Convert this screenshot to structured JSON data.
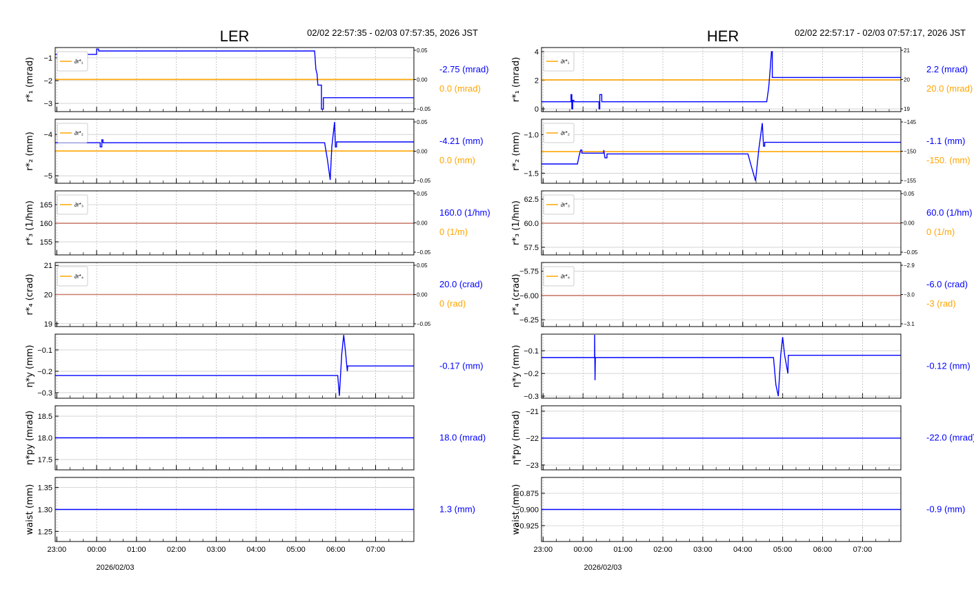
{
  "colors": {
    "series": "#0000ff",
    "reference": "#ffa500",
    "overlap": "#c87d6e",
    "grid": "#cccccc"
  },
  "chart_data": [
    {
      "type": "line",
      "title": "LER",
      "time_range": "02/02 22:57:35 - 02/03 07:57:35, 2026 JST",
      "xlabel": "2026/02/03",
      "x_unit": "hours since 02/02 23:00",
      "xlim": [
        -0.04,
        8.96
      ],
      "xticks": [
        0,
        1,
        2,
        3,
        4,
        5,
        6,
        7,
        8
      ],
      "xtick_labels": [
        "23:00",
        "00:00",
        "01:00",
        "02:00",
        "03:00",
        "04:00",
        "05:00",
        "06:00",
        "07:00"
      ],
      "panels": [
        {
          "ylabel": "r*₁ (mrad)",
          "ylim": [
            -3.36,
            -0.55
          ],
          "yticks": [
            -1,
            -2,
            -3
          ],
          "ytick_labels": [
            "−1",
            "−2",
            "−3"
          ],
          "right_ticks": [
            "0.05",
            "0.00",
            "−0.05"
          ],
          "legend": "∂r*₁",
          "series": [
            [
              -0.04,
              -0.85
            ],
            [
              1.0,
              -0.85
            ],
            [
              1.0,
              -0.62
            ],
            [
              1.05,
              -0.62
            ],
            [
              1.05,
              -0.7
            ],
            [
              6.47,
              -0.7
            ],
            [
              6.5,
              -1.5
            ],
            [
              6.53,
              -1.7
            ],
            [
              6.55,
              -2.2
            ],
            [
              6.64,
              -2.2
            ],
            [
              6.64,
              -3.25
            ],
            [
              6.69,
              -3.25
            ],
            [
              6.69,
              -2.75
            ],
            [
              8.96,
              -2.75
            ]
          ],
          "reference": -1.95,
          "value": "-2.75 (mrad)",
          "ref_value": "0.0 (mrad)"
        },
        {
          "ylabel": "r*₂ (mm)",
          "ylim": [
            -5.18,
            -3.63
          ],
          "yticks": [
            -4,
            -5
          ],
          "ytick_labels": [
            "−4",
            "−5"
          ],
          "right_ticks": [
            "0.05",
            "0.00",
            "−0.05"
          ],
          "legend": "∂r*₂",
          "series": [
            [
              -0.04,
              -4.2
            ],
            [
              1.09,
              -4.2
            ],
            [
              1.09,
              -4.3
            ],
            [
              1.13,
              -4.3
            ],
            [
              1.13,
              -4.13
            ],
            [
              1.16,
              -4.13
            ],
            [
              1.16,
              -4.2
            ],
            [
              6.72,
              -4.2
            ],
            [
              6.79,
              -4.6
            ],
            [
              6.86,
              -5.1
            ],
            [
              6.9,
              -4.3
            ],
            [
              6.97,
              -3.7
            ],
            [
              6.99,
              -4.3
            ],
            [
              7.02,
              -4.3
            ],
            [
              7.02,
              -4.18
            ],
            [
              8.96,
              -4.18
            ]
          ],
          "reference": -4.4,
          "value": "-4.21 (mm)",
          "ref_value": "0.0 (mm)"
        },
        {
          "ylabel": "r*₃ (1/hm)",
          "ylim": [
            151.5,
            168.7
          ],
          "yticks": [
            165,
            160,
            155
          ],
          "ytick_labels": [
            "165",
            "160",
            "155"
          ],
          "right_ticks": [
            "0.05",
            "0.00",
            "−0.05"
          ],
          "legend": "∂r*₃",
          "series": [
            [
              -0.04,
              160
            ],
            [
              8.96,
              160
            ]
          ],
          "reference": 160,
          "value": "160.0 (1/hm)",
          "ref_value": "0 (1/m)"
        },
        {
          "ylabel": "r*₄ (crad)",
          "ylim": [
            18.9,
            21.1
          ],
          "yticks": [
            21,
            20,
            19
          ],
          "ytick_labels": [
            "21",
            "20",
            "19"
          ],
          "right_ticks": [
            "0.05",
            "0.00",
            "−0.05"
          ],
          "legend": "∂r*₄",
          "series": [
            [
              -0.04,
              20
            ],
            [
              8.96,
              20
            ]
          ],
          "reference": 20,
          "value": "20.0 (crad)",
          "ref_value": "0 (rad)"
        },
        {
          "ylabel": "η*y (mm)",
          "ylim": [
            -0.326,
            -0.026
          ],
          "yticks": [
            -0.1,
            -0.2,
            -0.3
          ],
          "ytick_labels": [
            "−0.1",
            "−0.2",
            "−0.3"
          ],
          "right_ticks": [],
          "legend": "",
          "series": [
            [
              -0.04,
              -0.22
            ],
            [
              7.05,
              -0.22
            ],
            [
              7.09,
              -0.315
            ],
            [
              7.15,
              -0.12
            ],
            [
              7.2,
              -0.03
            ],
            [
              7.25,
              -0.12
            ],
            [
              7.29,
              -0.2
            ],
            [
              7.3,
              -0.175
            ],
            [
              8.96,
              -0.175
            ]
          ],
          "reference": null,
          "value": "-0.17 (mm)",
          "ref_value": ""
        },
        {
          "ylabel": "η*py (mrad)",
          "ylim": [
            17.26,
            18.74
          ],
          "yticks": [
            18.5,
            18.0,
            17.5
          ],
          "ytick_labels": [
            "18.5",
            "18.0",
            "17.5"
          ],
          "right_ticks": [],
          "legend": "",
          "series": [
            [
              -0.04,
              18.0
            ],
            [
              8.96,
              18.0
            ]
          ],
          "reference": null,
          "value": "18.0 (mrad)",
          "ref_value": ""
        },
        {
          "ylabel": "waist (mm)",
          "ylim": [
            1.227,
            1.373
          ],
          "yticks": [
            1.35,
            1.3,
            1.25
          ],
          "ytick_labels": [
            "1.35",
            "1.30",
            "1.25"
          ],
          "right_ticks": [],
          "legend": "",
          "series": [
            [
              -0.04,
              1.3
            ],
            [
              8.96,
              1.3
            ]
          ],
          "reference": null,
          "value": "1.3 (mm)",
          "ref_value": ""
        }
      ]
    },
    {
      "type": "line",
      "title": "HER",
      "time_range": "02/02 22:57:17 - 02/03 07:57:17, 2026 JST",
      "xlabel": "2026/02/03",
      "x_unit": "hours since 02/02 23:00",
      "xlim": [
        -0.04,
        8.96
      ],
      "xticks": [
        0,
        1,
        2,
        3,
        4,
        5,
        6,
        7,
        8
      ],
      "xtick_labels": [
        "23:00",
        "00:00",
        "01:00",
        "02:00",
        "03:00",
        "04:00",
        "05:00",
        "06:00",
        "07:00"
      ],
      "panels": [
        {
          "ylabel": "r*₁ (mrad)",
          "ylim": [
            -0.19,
            4.29
          ],
          "yticks": [
            4,
            2,
            0
          ],
          "ytick_labels": [
            "4",
            "2",
            "0"
          ],
          "right_ticks": [
            "21",
            "20",
            "19"
          ],
          "legend": "∂r*₁",
          "series": [
            [
              -0.04,
              0.5
            ],
            [
              0.7,
              0.5
            ],
            [
              0.7,
              1.0
            ],
            [
              0.72,
              1.0
            ],
            [
              0.72,
              0.0
            ],
            [
              0.74,
              0.0
            ],
            [
              0.74,
              0.6
            ],
            [
              0.77,
              0.6
            ],
            [
              0.77,
              0.5
            ],
            [
              1.4,
              0.5
            ],
            [
              1.4,
              0.0
            ],
            [
              1.42,
              0.0
            ],
            [
              1.42,
              1.0
            ],
            [
              1.47,
              1.0
            ],
            [
              1.47,
              0.5
            ],
            [
              5.6,
              0.5
            ],
            [
              5.65,
              1.5
            ],
            [
              5.68,
              2.5
            ],
            [
              5.72,
              4.0
            ],
            [
              5.74,
              4.0
            ],
            [
              5.74,
              2.2
            ],
            [
              8.96,
              2.2
            ]
          ],
          "reference": 2.03,
          "value": "2.2 (mrad)",
          "ref_value": "20.0 (mrad)"
        },
        {
          "ylabel": "r*₂ (mm)",
          "ylim": [
            -1.63,
            -0.8
          ],
          "yticks": [
            -1.0,
            -1.5
          ],
          "ytick_labels": [
            "−1.0",
            "−1.5"
          ],
          "right_ticks": [
            "−145",
            "−150",
            "−155"
          ],
          "legend": "∂r*₂",
          "series": [
            [
              -0.04,
              -1.38
            ],
            [
              0.86,
              -1.38
            ],
            [
              0.9,
              -1.28
            ],
            [
              0.94,
              -1.2
            ],
            [
              0.97,
              -1.2
            ],
            [
              0.97,
              -1.24
            ],
            [
              1.52,
              -1.24
            ],
            [
              1.52,
              -1.2
            ],
            [
              1.55,
              -1.3
            ],
            [
              1.6,
              -1.3
            ],
            [
              1.6,
              -1.25
            ],
            [
              5.13,
              -1.25
            ],
            [
              5.22,
              -1.42
            ],
            [
              5.32,
              -1.6
            ],
            [
              5.4,
              -1.2
            ],
            [
              5.49,
              -0.85
            ],
            [
              5.52,
              -1.15
            ],
            [
              5.55,
              -1.15
            ],
            [
              5.55,
              -1.1
            ],
            [
              8.96,
              -1.1
            ]
          ],
          "reference": -1.22,
          "value": "-1.1 (mm)",
          "ref_value": "-150. (mm)"
        },
        {
          "ylabel": "r*₃ (1/hm)",
          "ylim": [
            56.71,
            63.36
          ],
          "yticks": [
            62.5,
            60.0,
            57.5
          ],
          "ytick_labels": [
            "62.5",
            "60.0",
            "57.5"
          ],
          "right_ticks": [
            "0.05",
            "0.00",
            "−0.05"
          ],
          "legend": "∂r*₃",
          "series": [
            [
              -0.04,
              60
            ],
            [
              8.96,
              60
            ]
          ],
          "reference": 60,
          "value": "60.0 (1/hm)",
          "ref_value": "0 (1/m)"
        },
        {
          "ylabel": "r*₄ (crad)",
          "ylim": [
            -6.32,
            -5.66
          ],
          "yticks": [
            -5.75,
            -6.0,
            -6.25
          ],
          "ytick_labels": [
            "−5.75",
            "−6.00",
            "−6.25"
          ],
          "right_ticks": [
            "−2.9",
            "−3.0",
            "−3.1"
          ],
          "legend": "∂r*₄",
          "series": [
            [
              -0.04,
              -6.0
            ],
            [
              8.96,
              -6.0
            ]
          ],
          "reference": -6.0,
          "value": "-6.0 (crad)",
          "ref_value": "-3 (rad)"
        },
        {
          "ylabel": "η*y (mm)",
          "ylim": [
            -0.309,
            -0.027
          ],
          "yticks": [
            -0.1,
            -0.2,
            -0.3
          ],
          "ytick_labels": [
            "−0.1",
            "−0.2",
            "−0.3"
          ],
          "right_ticks": [],
          "legend": "",
          "series": [
            [
              -0.04,
              -0.13
            ],
            [
              1.29,
              -0.13
            ],
            [
              1.29,
              -0.03
            ],
            [
              1.3,
              -0.23
            ],
            [
              1.31,
              -0.13
            ],
            [
              5.77,
              -0.13
            ],
            [
              5.83,
              -0.25
            ],
            [
              5.89,
              -0.3
            ],
            [
              5.95,
              -0.12
            ],
            [
              6.0,
              -0.04
            ],
            [
              6.05,
              -0.12
            ],
            [
              6.13,
              -0.2
            ],
            [
              6.14,
              -0.12
            ],
            [
              8.96,
              -0.12
            ]
          ],
          "reference": null,
          "value": "-0.12 (mm)",
          "ref_value": ""
        },
        {
          "ylabel": "η*py (mrad)",
          "ylim": [
            -23.18,
            -20.8
          ],
          "yticks": [
            -21,
            -22,
            -23
          ],
          "ytick_labels": [
            "−21",
            "−22",
            "−23"
          ],
          "right_ticks": [],
          "legend": "",
          "series": [
            [
              -0.04,
              -22
            ],
            [
              8.96,
              -22
            ]
          ],
          "reference": null,
          "value": "-22.0 (mrad)",
          "ref_value": ""
        },
        {
          "ylabel": "waist (mm)",
          "ylim": [
            -0.9495,
            -0.8505
          ],
          "yticks": [
            -0.875,
            -0.9,
            -0.925
          ],
          "ytick_labels": [
            "−0.875",
            "−0.900",
            "−0.925"
          ],
          "right_ticks": [],
          "legend": "",
          "series": [
            [
              -0.04,
              -0.9
            ],
            [
              8.96,
              -0.9
            ]
          ],
          "reference": null,
          "value": "-0.9 (mm)",
          "ref_value": ""
        }
      ]
    }
  ]
}
